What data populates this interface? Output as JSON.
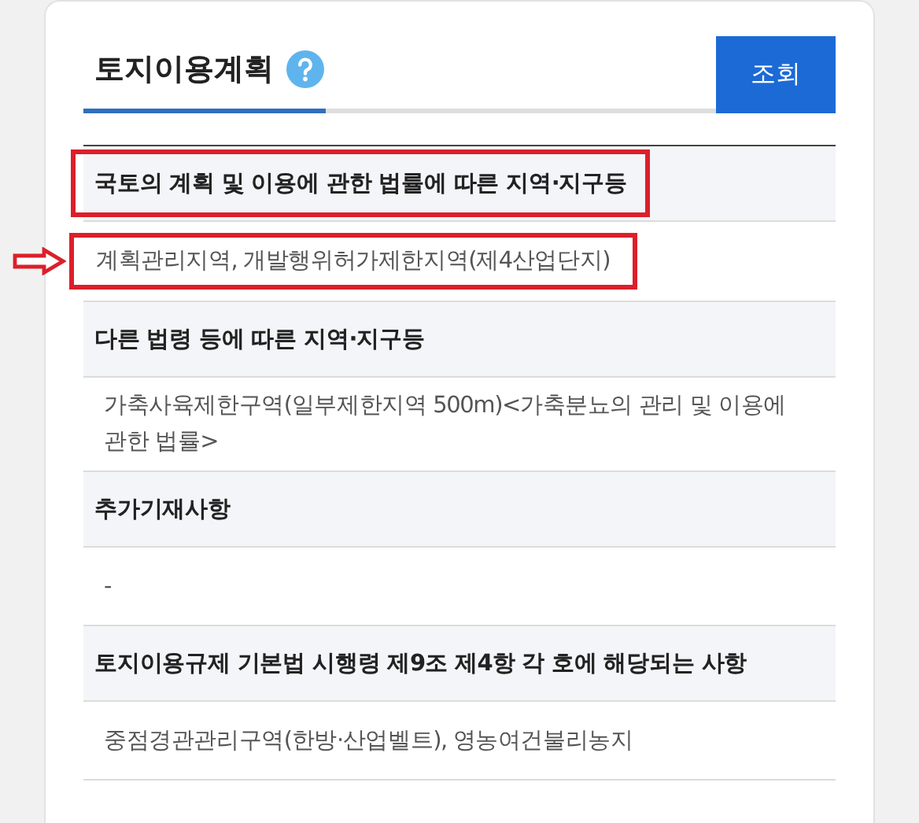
{
  "panel": {
    "title": "토지이용계획",
    "tab_selected": true,
    "button": "조회"
  },
  "sections": [
    {
      "heading": "국토의 계획 및 이용에 관한 법률에 따른 지역·지구등",
      "heading_highlighted": true,
      "value": "계획관리지역, 개발행위허가제한지역(제4산업단지)",
      "value_highlighted": true,
      "value_arrow": true
    },
    {
      "heading": "다른 법령 등에 따른 지역·지구등",
      "heading_highlighted": false,
      "value": "가축사육제한구역(일부제한지역 500m)<가축분뇨의 관리 및 이용에 관한 법률>",
      "value_highlighted": false,
      "value_arrow": false
    },
    {
      "heading": "추가기재사항",
      "heading_highlighted": false,
      "value": "-",
      "value_highlighted": false,
      "value_arrow": false
    },
    {
      "heading": "토지이용규제 기본법 시행령 제9조 제4항 각 호에 해당되는 사항",
      "heading_highlighted": false,
      "value": "중점경관관리구역(한방·산업벨트), 영농여건불리농지",
      "value_highlighted": false,
      "value_arrow": false
    }
  ]
}
